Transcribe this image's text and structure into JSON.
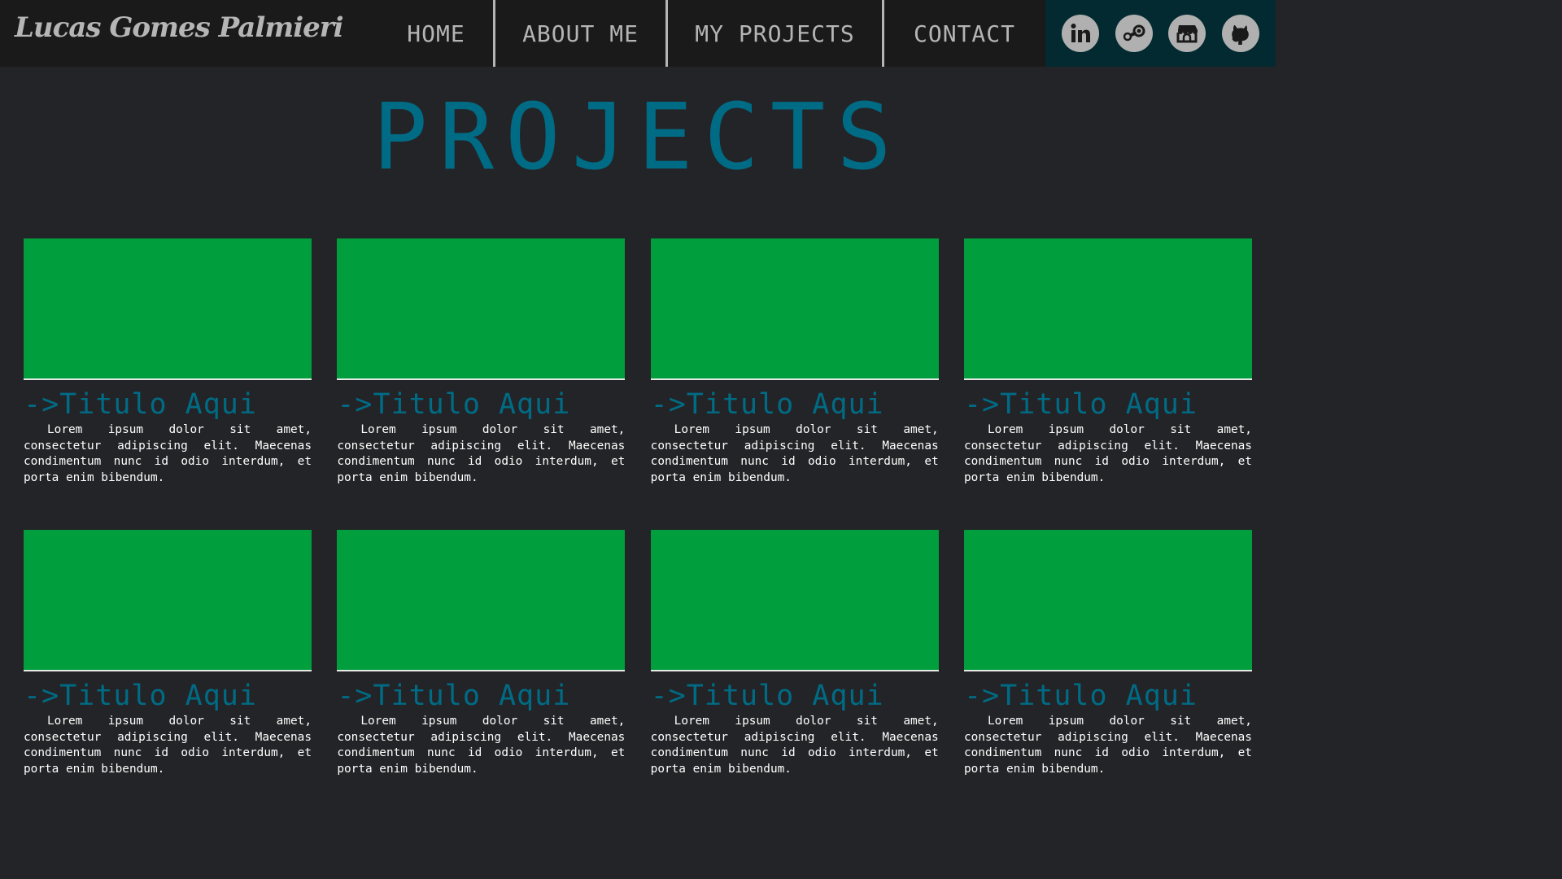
{
  "brand": "Lucas Gomes Palmieri",
  "nav": [
    {
      "label": "HOME"
    },
    {
      "label": "ABOUT ME"
    },
    {
      "label": "MY PROJECTS"
    },
    {
      "label": "CONTACT"
    }
  ],
  "social": [
    {
      "icon": "linkedin-icon"
    },
    {
      "icon": "steam-icon"
    },
    {
      "icon": "itchio-icon"
    },
    {
      "icon": "github-icon"
    }
  ],
  "heading": "PROJECTS",
  "projects": [
    {
      "title": "->Titulo Aqui",
      "description": "Lorem ipsum dolor sit amet, consectetur adipiscing elit. Maecenas condimentum nunc id odio interdum, et porta enim bibendum."
    },
    {
      "title": "->Titulo Aqui",
      "description": "Lorem ipsum dolor sit amet, consectetur adipiscing elit. Maecenas condimentum nunc id odio interdum, et porta enim bibendum."
    },
    {
      "title": "->Titulo Aqui",
      "description": "Lorem ipsum dolor sit amet, consectetur adipiscing elit. Maecenas condimentum nunc id odio interdum, et porta enim bibendum."
    },
    {
      "title": "->Titulo Aqui",
      "description": "Lorem ipsum dolor sit amet, consectetur adipiscing elit. Maecenas condimentum nunc id odio interdum, et porta enim bibendum."
    },
    {
      "title": "->Titulo Aqui",
      "description": "Lorem ipsum dolor sit amet, consectetur adipiscing elit. Maecenas condimentum nunc id odio interdum, et porta enim bibendum."
    },
    {
      "title": "->Titulo Aqui",
      "description": "Lorem ipsum dolor sit amet, consectetur adipiscing elit. Maecenas condimentum nunc id odio interdum, et porta enim bibendum."
    },
    {
      "title": "->Titulo Aqui",
      "description": "Lorem ipsum dolor sit amet, consectetur adipiscing elit. Maecenas condimentum nunc id odio interdum, et porta enim bibendum."
    },
    {
      "title": "->Titulo Aqui",
      "description": "Lorem ipsum dolor sit amet, consectetur adipiscing elit. Maecenas condimentum nunc id odio interdum, et porta enim bibendum."
    }
  ],
  "colors": {
    "accent": "#006b85",
    "thumbnail": "#009e3c",
    "background": "#232427",
    "navbar": "#1a1a1a",
    "social_bar": "#032a31"
  }
}
